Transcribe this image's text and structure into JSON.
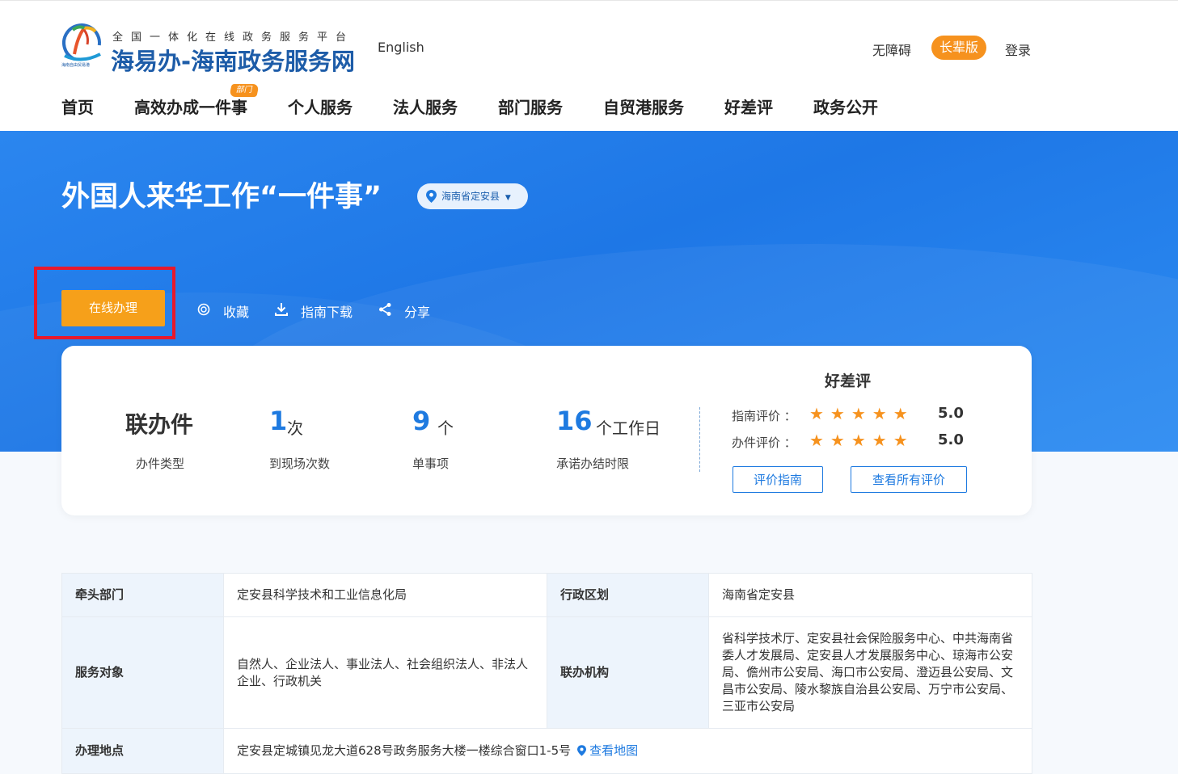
{
  "header": {
    "slogan": "全国一体化在线政务服务平台",
    "site_title": "海易办-海南政务服务网",
    "logo_small_text": "海南自由贸易港",
    "english_label": "English",
    "accessibility_label": "无障碍",
    "elder_label": "长辈版",
    "login_label": "登录"
  },
  "nav": {
    "items": [
      {
        "label": "首页"
      },
      {
        "label": "高效办成一件事"
      },
      {
        "label": "个人服务"
      },
      {
        "label": "法人服务"
      },
      {
        "label": "部门服务"
      },
      {
        "label": "自贸港服务"
      },
      {
        "label": "好差评"
      },
      {
        "label": "政务公开"
      }
    ],
    "badge": "部门"
  },
  "banner": {
    "title": "外国人来华工作“一件事”",
    "region": "海南省定安县",
    "online_button": "在线办理",
    "actions": {
      "favorite": "收藏",
      "download": "指南下载",
      "share": "分享"
    }
  },
  "stats": {
    "type_value": "联办件",
    "type_label": "办件类型",
    "visits_value": "1",
    "visits_unit": "次",
    "visits_label": "到现场次数",
    "items_value": "9",
    "items_unit": "个",
    "items_label": "单事项",
    "days_value": "16",
    "days_unit": "个工作日",
    "days_label": "承诺办结时限"
  },
  "rating": {
    "title": "好差评",
    "guide_label": "指南评价 ：",
    "guide_score": "5.0",
    "guide_stars": 5,
    "handle_label": "办件评价 ：",
    "handle_score": "5.0",
    "handle_stars": 5,
    "guide_button": "评价指南",
    "all_button": "查看所有评价"
  },
  "info": {
    "lead_dept_key": "牵头部门",
    "lead_dept_value": "定安县科学技术和工业信息化局",
    "region_key": "行政区划",
    "region_value": "海南省定安县",
    "target_key": "服务对象",
    "target_value": "自然人、企业法人、事业法人、社会组织法人、非法人企业、行政机关",
    "joint_key": "联办机构",
    "joint_value": "省科学技术厅、定安县社会保险服务中心、中共海南省委人才发展局、定安县人才发展服务中心、琼海市公安局、儋州市公安局、海口市公安局、澄迈县公安局、文昌市公安局、陵水黎族自治县公安局、万宁市公安局、三亚市公安局",
    "location_key": "办理地点",
    "location_value": "定安县定城镇见龙大道628号政务服务大楼一楼综合窗口1-5号",
    "map_link": "查看地图"
  },
  "colors": {
    "primary_blue": "#1e7ae0",
    "banner_blue": "#2384ee",
    "orange": "#f6a01a",
    "highlight_red": "#e8192c"
  }
}
